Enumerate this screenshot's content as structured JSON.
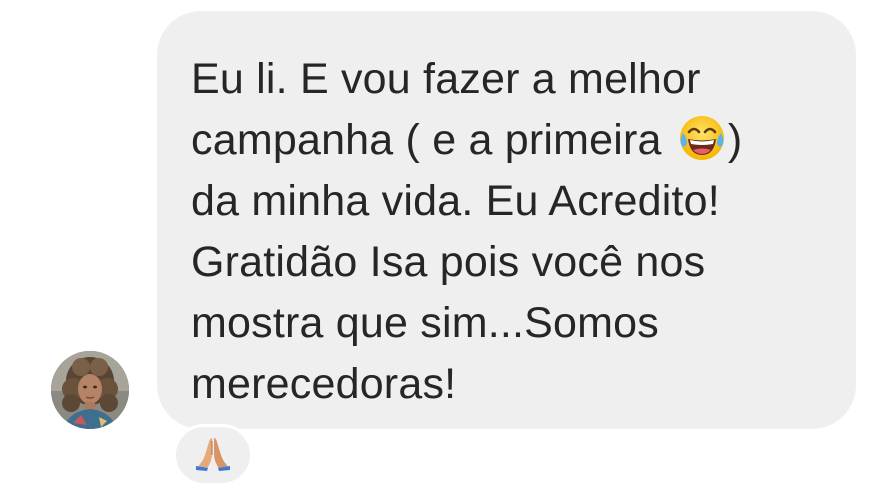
{
  "message": {
    "lines": [
      "Eu li. E vou fazer a melhor",
      "campanha ( e a primeira ",
      ")",
      "da minha vida. Eu Acredito!",
      "Gratidão Isa pois você nos",
      "mostra que sim...Somos",
      "merecedoras!"
    ],
    "inline_emoji": "face-with-tears-of-joy-icon"
  },
  "reaction": {
    "icon": "folded-hands-icon"
  },
  "colors": {
    "bubble_bg": "#efefef",
    "text": "#262626"
  }
}
